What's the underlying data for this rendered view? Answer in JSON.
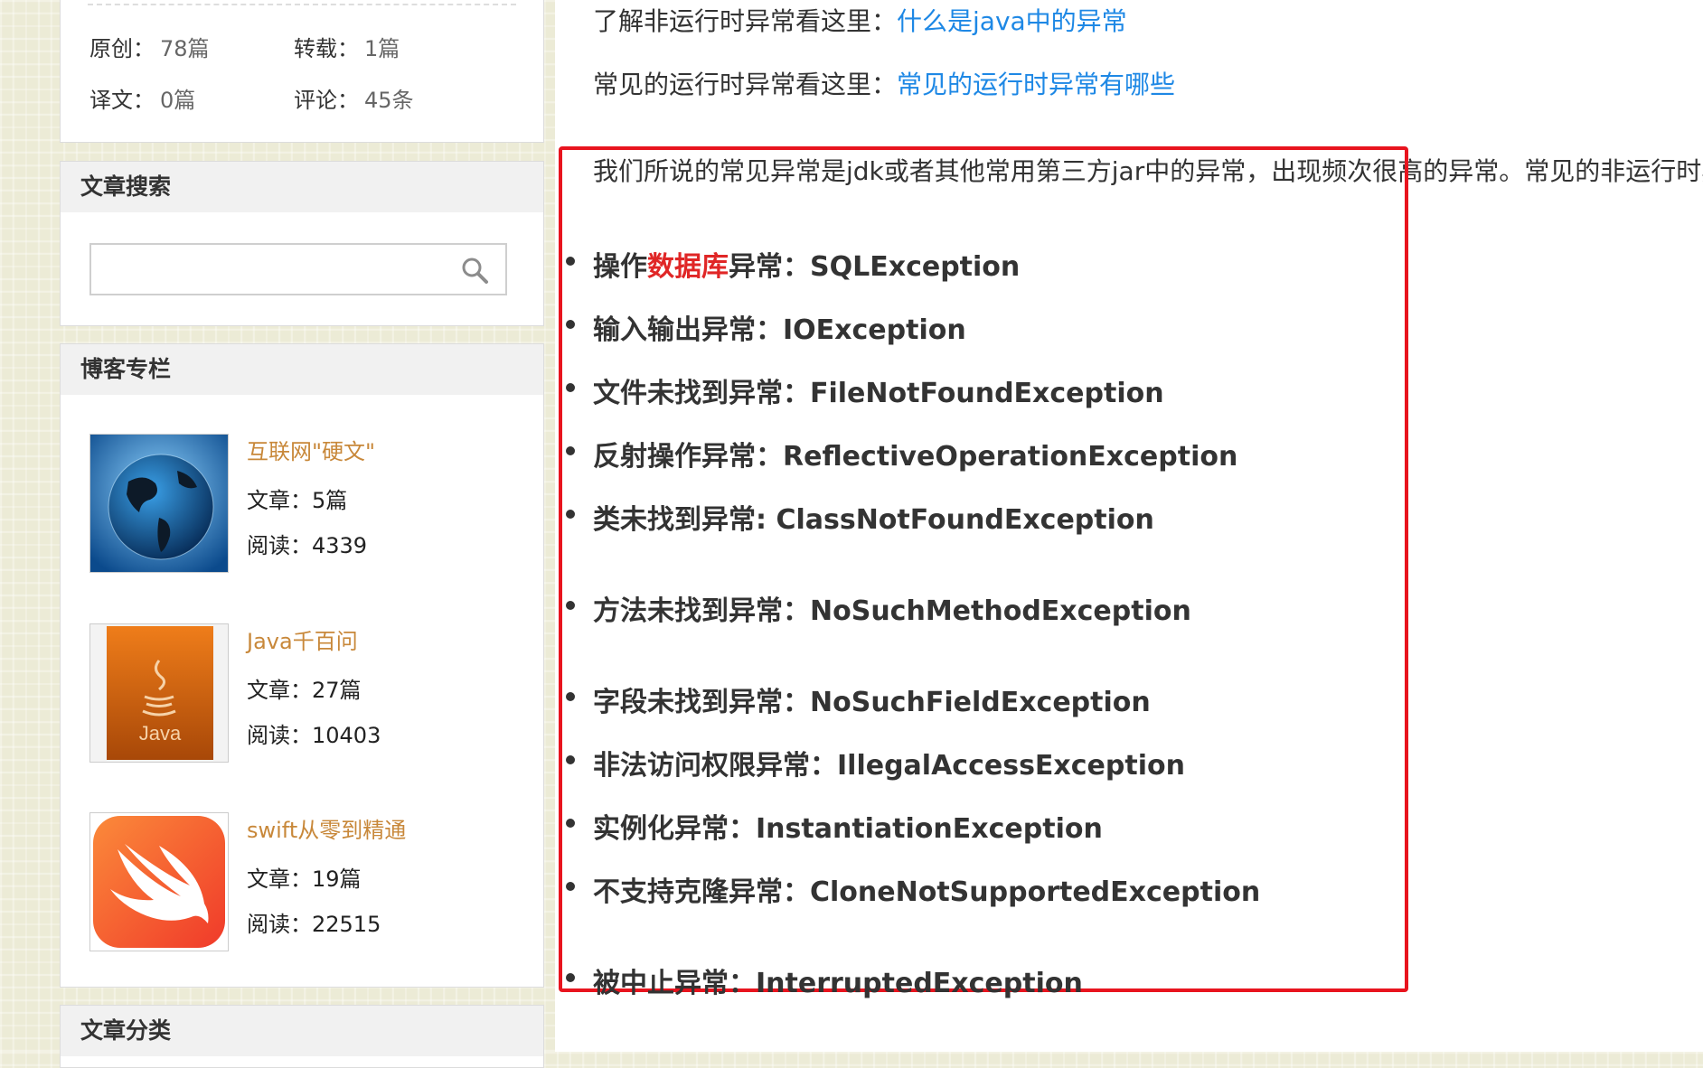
{
  "stats": {
    "original_label": "原创：",
    "original_value": "78篇",
    "repost_label": "转载：",
    "repost_value": "1篇",
    "translate_label": "译文：",
    "translate_value": "0篇",
    "comment_label": "评论：",
    "comment_value": "45条"
  },
  "search": {
    "title": "文章搜索",
    "placeholder": "",
    "icon": "search-icon"
  },
  "columns": {
    "title": "博客专栏",
    "items": [
      {
        "name": "互联网\"硬文\"",
        "articles": "文章：5篇",
        "reads": "阅读：4339",
        "thumb": "globe"
      },
      {
        "name": "Java千百问",
        "articles": "文章：27篇",
        "reads": "阅读：10403",
        "thumb": "java",
        "thumb_text": "Java"
      },
      {
        "name": "swift从零到精通",
        "articles": "文章：19篇",
        "reads": "阅读：22515",
        "thumb": "swift"
      }
    ]
  },
  "category": {
    "title": "文章分类"
  },
  "article": {
    "intro1_prefix": "了解非运行时异常看这里：",
    "intro1_link": "什么是java中的异常",
    "intro2_prefix": "常见的运行时异常看这里：",
    "intro2_link": "常见的运行时异常有哪些",
    "paragraph": "我们所说的常见异常是jdk或者其他常用第三方jar中的异常，出现频次很高的异常。常见的非运行时异",
    "exceptions": [
      {
        "pre": "操作",
        "kw": "数据库",
        "post": "异常：SQLException"
      },
      {
        "pre": "输入输出异常：IOException"
      },
      {
        "pre": "文件未找到异常：FileNotFoundException"
      },
      {
        "pre": "反射操作异常：ReflectiveOperationException"
      },
      {
        "pre": "类未找到异常: ClassNotFoundException"
      },
      {
        "pre": "方法未找到异常：NoSuchMethodException"
      },
      {
        "pre": "字段未找到异常：NoSuchFieldException"
      },
      {
        "pre": "非法访问权限异常：IllegalAccessException"
      },
      {
        "pre": "实例化异常：InstantiationException"
      },
      {
        "pre": "不支持克隆异常：CloneNotSupportedException"
      },
      {
        "pre": "被中止异常：InterruptedException"
      }
    ]
  },
  "colors": {
    "link": "#1e88e5",
    "highlight_border": "#e8141e",
    "keyword": "#e02626",
    "column_title": "#c8883a"
  }
}
